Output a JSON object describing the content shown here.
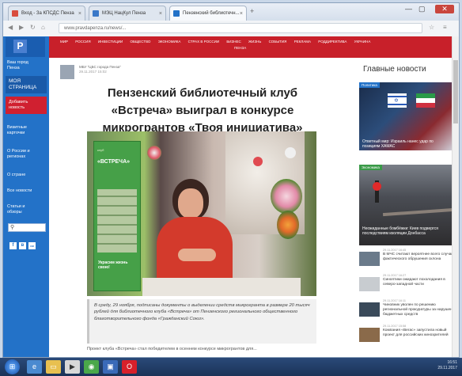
{
  "browser": {
    "tabs": [
      {
        "label": "Вход - За КПСДС Пенза",
        "active": false
      },
      {
        "label": "МЭЦ НацКул Пенза",
        "active": false
      },
      {
        "label": "Пензенский библиотечн...",
        "active": true
      }
    ],
    "new_tab": "+",
    "window_controls": [
      "—",
      "▢",
      "✕"
    ],
    "url": "www.pravdapenza.ru/news/..."
  },
  "site": {
    "logo": "Р",
    "nav_items": [
      "МИР",
      "РОССИЯ",
      "ИНВЕСТИЦИИ",
      "ОБЩЕСТВО",
      "ЭКОНОМИКА",
      "СТРАХ В РОССИИ",
      "БИЗНЕС",
      "ЖИЗНЬ",
      "СОБЫТИЯ",
      "РЕКЛАМА",
      "РОДДИРЕКТИВА",
      "УКРАИНА",
      "ПЕНЗА"
    ],
    "sidebar": {
      "city": "Ваш город\nПенза",
      "my_page": "МОЯ\nСТРАНИЦА",
      "add_news": "Добавить\nновость",
      "links": [
        "Визитные\nкарточки",
        "О России и\nрегионах",
        "О стране",
        "Все новости",
        "Статьи и\nобзоры"
      ]
    },
    "social": [
      "f",
      "в",
      "ок"
    ]
  },
  "article": {
    "author": "МБУ \"ЦБС города Пенза\"",
    "date": "29.11.2017 15:02",
    "title": "Пензенский библиотечный клуб «Встреча» выиграл в конкурсе микрогрантов «Твоя инициатива»",
    "banner_top": "клуб",
    "banner_name": "«ВСТРЕЧА»",
    "banner_slogan": "Украсим жизнь свою!",
    "caption": "В среду, 29 ноября, подписаны документы о выделении средств микрогранта в размере 20 тысяч рублей для библиотечного клуба «Встреча» от Пензенского регионального общественного благотворительного фонда «Гражданский Союз».",
    "body": "Проект клуба «Встреча» стал победителем в осеннем конкурсе микрогрантов для..."
  },
  "news": {
    "heading": "Главные новости",
    "cards": [
      {
        "tag": "Политика",
        "caption": "Ответный мир: Израиль нанес удар по позициям ХАМАС"
      },
      {
        "tag": "Экономика",
        "caption": "Неожиданные бомбёжки: Киев подвергся последствиям изоляции Донбасса"
      }
    ],
    "items": [
      {
        "date": "29.11.2017 16:45",
        "text": "В МЧС считают вероятнее всего случаи фактического обрушения склона"
      },
      {
        "date": "29.11.2017 16:27",
        "text": "Синоптики ожидают похолодания в северо-западной части"
      },
      {
        "date": "29.11.2017 16:11",
        "text": "Чиновник уволен по решению региональной прокуратуры за нарушения бюджетных средств"
      },
      {
        "date": "29.11.2017 15:58",
        "text": "Компания «Вегас» запустила новый проект для российских кинозрителей"
      }
    ]
  },
  "taskbar": {
    "start": "⊞",
    "tray_time": "16:51",
    "tray_date": "29.11.2017"
  },
  "colors": {
    "nav_red": "#c8202a",
    "sidebar_blue": "#2372c8",
    "accent_red": "#d02030"
  }
}
